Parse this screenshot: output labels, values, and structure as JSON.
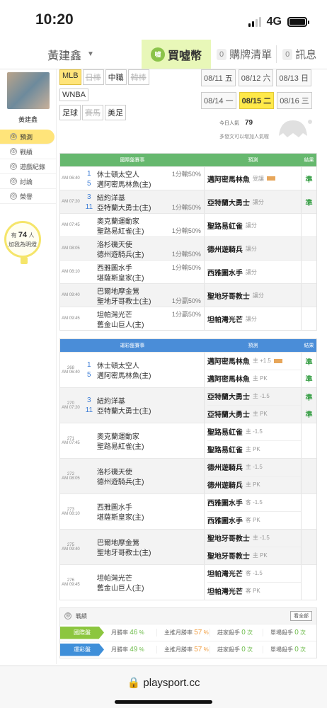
{
  "status": {
    "time": "10:20",
    "network": "4G"
  },
  "nav": {
    "user": "黃建鑫",
    "coin_icon": "嘘",
    "coin": "買噓幣",
    "purchase_count": "0",
    "purchase": "購牌清單",
    "msg_count": "0",
    "msg": "訊息"
  },
  "sidebar": {
    "name": "黃建鑫",
    "items": [
      "預測",
      "戰績",
      "遊戲紀錄",
      "討論",
      "榮譽"
    ],
    "fans_prefix": "有",
    "fans_count": "74",
    "fans_unit": "人",
    "fans_text": "加我為明燈"
  },
  "leagues": [
    [
      "MLB",
      "日棒",
      "中職",
      "韓棒"
    ],
    [
      "WNBA"
    ],
    [
      "足球",
      "賽馬",
      "美足"
    ]
  ],
  "dates": [
    [
      "08/11 五",
      "08/12 六",
      "08/13 日"
    ],
    [
      "08/14 一",
      "08/15 二",
      "08/16 三"
    ]
  ],
  "popularity": {
    "label": "今日人氣",
    "value": "79",
    "hint": "多發文可以增加人氣喔"
  },
  "intl": {
    "head": [
      "國際盤賽事",
      "預測",
      "結果"
    ],
    "rows": [
      {
        "time": "AM 06:40",
        "n1": "1",
        "n2": "5",
        "t1": "休士頓太空人",
        "t2": "邁阿密馬林魚(主)",
        "line": "1分輸50%",
        "line_row": 0,
        "pred": "邁阿密馬林魚",
        "note": "受讓",
        "res": "準"
      },
      {
        "time": "AM 07:20",
        "n1": "3",
        "n2": "11",
        "t1": "紐約洋基",
        "t2": "亞特蘭大勇士(主)",
        "line": "1分輸50%",
        "line_row": 1,
        "pred": "亞特蘭大勇士",
        "note": "讓分",
        "res": "準"
      },
      {
        "time": "AM 07:45",
        "n1": "",
        "n2": "",
        "t1": "奧克蘭運動家",
        "t2": "聖路易紅雀(主)",
        "line": "1分輸50%",
        "line_row": 1,
        "pred": "聖路易紅雀",
        "note": "讓分",
        "res": ""
      },
      {
        "time": "AM 08:05",
        "n1": "",
        "n2": "",
        "t1": "洛杉磯天使",
        "t2": "德州遊騎兵(主)",
        "line": "1分輸50%",
        "line_row": 1,
        "pred": "德州遊騎兵",
        "note": "讓分",
        "res": ""
      },
      {
        "time": "AM 08:10",
        "n1": "",
        "n2": "",
        "t1": "西雅圖水手",
        "t2": "堪薩斯皇家(主)",
        "line": "1分輸50%",
        "line_row": 0,
        "pred": "西雅圖水手",
        "note": "讓分",
        "res": ""
      },
      {
        "time": "AM 09:40",
        "n1": "",
        "n2": "",
        "t1": "巴爾地摩金鶯",
        "t2": "聖地牙哥教士(主)",
        "line": "1分贏50%",
        "line_row": 1,
        "pred": "聖地牙哥教士",
        "note": "讓分",
        "res": ""
      },
      {
        "time": "AM 09:45",
        "n1": "",
        "n2": "",
        "t1": "坦帕灣光芒",
        "t2": "舊金山巨人(主)",
        "line": "1分贏50%",
        "line_row": 0,
        "pred": "坦帕灣光芒",
        "note": "讓分",
        "res": ""
      }
    ]
  },
  "lottery": {
    "head": [
      "運彩盤賽事",
      "預測",
      "結果"
    ],
    "rows": [
      {
        "id": "268",
        "time": "AM 06:40",
        "n1": "1",
        "n2": "5",
        "t1": "休士頓太空人",
        "t2": "邁阿密馬林魚(主)",
        "p": [
          [
            "邁阿密馬林魚",
            "主 +1.5",
            "準"
          ],
          [
            "邁阿密馬林魚",
            "主 PK",
            "準"
          ]
        ]
      },
      {
        "id": "270",
        "time": "AM 07:20",
        "n1": "3",
        "n2": "11",
        "t1": "紐約洋基",
        "t2": "亞特蘭大勇士(主)",
        "p": [
          [
            "亞特蘭大勇士",
            "主 -1.5",
            "準"
          ],
          [
            "亞特蘭大勇士",
            "主 PK",
            "準"
          ]
        ]
      },
      {
        "id": "271",
        "time": "AM 07:45",
        "n1": "",
        "n2": "",
        "t1": "奧克蘭運動家",
        "t2": "聖路易紅雀(主)",
        "p": [
          [
            "聖路易紅雀",
            "主 -1.5",
            ""
          ],
          [
            "聖路易紅雀",
            "主 PK",
            ""
          ]
        ]
      },
      {
        "id": "272",
        "time": "AM 08:05",
        "n1": "",
        "n2": "",
        "t1": "洛杉磯天使",
        "t2": "德州遊騎兵(主)",
        "p": [
          [
            "德州遊騎兵",
            "主 -1.5",
            ""
          ],
          [
            "德州遊騎兵",
            "主 PK",
            ""
          ]
        ]
      },
      {
        "id": "273",
        "time": "AM 08:10",
        "n1": "",
        "n2": "",
        "t1": "西雅圖水手",
        "t2": "堪薩斯皇家(主)",
        "p": [
          [
            "西雅圖水手",
            "客 -1.5",
            ""
          ],
          [
            "西雅圖水手",
            "客 PK",
            ""
          ]
        ]
      },
      {
        "id": "275",
        "time": "AM 09:40",
        "n1": "",
        "n2": "",
        "t1": "巴爾地摩金鶯",
        "t2": "聖地牙哥教士(主)",
        "p": [
          [
            "聖地牙哥教士",
            "主 -1.5",
            ""
          ],
          [
            "聖地牙哥教士",
            "主 PK",
            ""
          ]
        ]
      },
      {
        "id": "276",
        "time": "AM 09:45",
        "n1": "",
        "n2": "",
        "t1": "坦帕灣光芒",
        "t2": "舊金山巨人(主)",
        "p": [
          [
            "坦帕灣光芒",
            "客 -1.5",
            ""
          ],
          [
            "坦帕灣光芒",
            "客 PK",
            ""
          ]
        ]
      }
    ]
  },
  "record": {
    "title": "戰績",
    "view_all": "看全部",
    "rows": [
      {
        "tag": "國際盤",
        "color": "#8cc63f",
        "m_label": "月勝率",
        "m": "46",
        "h_label": "主推月勝率",
        "h": "57",
        "k_label": "莊家殺手",
        "k": "0",
        "s_label": "單場殺手",
        "s": "0",
        "pct": "%",
        "unit": "次"
      },
      {
        "tag": "運彩盤",
        "color": "#3f8fd9",
        "m_label": "月勝率",
        "m": "49",
        "h_label": "主推月勝率",
        "h": "57",
        "k_label": "莊家殺手",
        "k": "0",
        "s_label": "單場殺手",
        "s": "0",
        "pct": "%",
        "unit": "次"
      }
    ]
  },
  "browser": {
    "url": "playsport.cc"
  }
}
